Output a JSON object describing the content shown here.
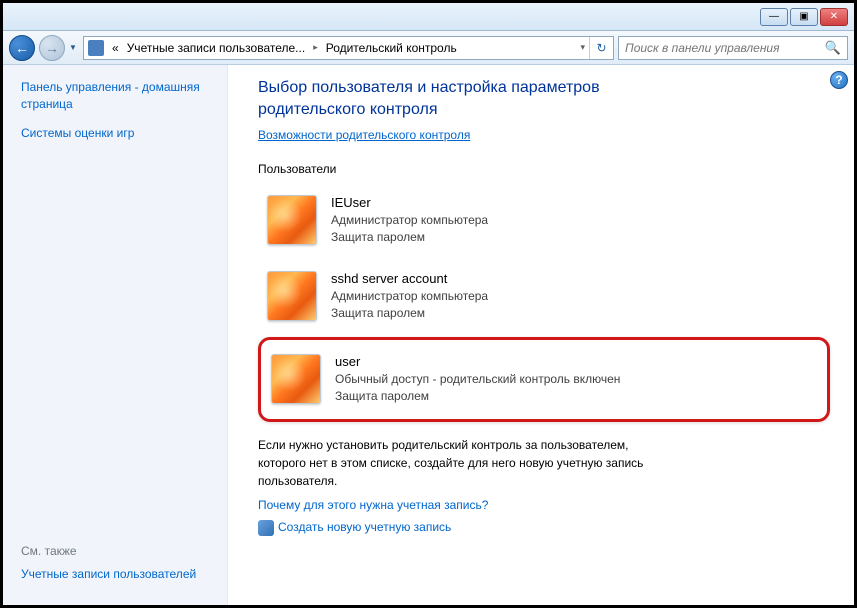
{
  "window": {
    "minimize": "—",
    "maximize": "▣",
    "close": "✕"
  },
  "nav": {
    "back": "←",
    "forward": "→",
    "dropdown": "▼",
    "refresh": "↻"
  },
  "address": {
    "seg1_prefix": "«",
    "seg1": "Учетные записи пользователе...",
    "seg2": "Родительский контроль",
    "chevron": "▸",
    "dd": "▾"
  },
  "search": {
    "placeholder": "Поиск в панели управления",
    "icon": "🔍"
  },
  "sidebar": {
    "link1": "Панель управления - домашняя страница",
    "link2": "Системы оценки игр",
    "see_also": "См. также",
    "link3": "Учетные записи пользователей"
  },
  "main": {
    "help": "?",
    "title": "Выбор пользователя и настройка параметров родительского контроля",
    "caps_link": "Возможности родительского контроля",
    "users_label": "Пользователи",
    "users": [
      {
        "name": "IEUser",
        "role": "Администратор компьютера",
        "prot": "Защита паролем",
        "hl": false
      },
      {
        "name": "sshd server account",
        "role": "Администратор компьютера",
        "prot": "Защита паролем",
        "hl": false
      },
      {
        "name": "user",
        "role": "Обычный доступ - родительский контроль включен",
        "prot": "Защита паролем",
        "hl": true
      }
    ],
    "note": "Если нужно установить родительский контроль за пользователем, которого нет в этом списке, создайте для него новую учетную запись пользователя.",
    "why_link": "Почему для этого нужна учетная запись?",
    "create_link": "Создать новую учетную запись"
  }
}
